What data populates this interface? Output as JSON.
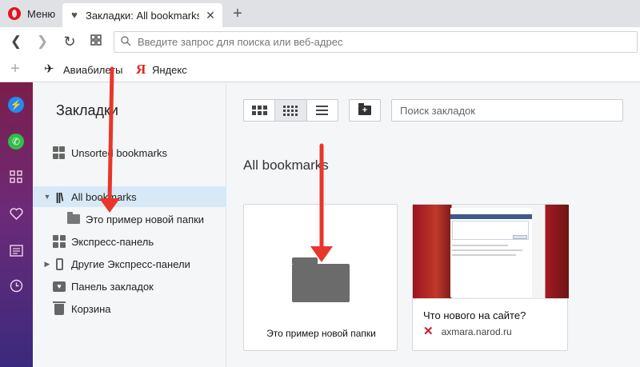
{
  "browser": {
    "menu_label": "Меню",
    "tab_title": "Закладки: All bookmarks",
    "tab_close": "✕",
    "new_tab": "+",
    "address_placeholder": "Введите запрос для поиска или веб-адрес"
  },
  "bookmarks_bar": {
    "add": "+",
    "items": [
      {
        "label": "Авиабилеты",
        "icon": "plane-icon"
      },
      {
        "label": "Яндекс",
        "icon": "yandex-icon"
      }
    ],
    "yandex_glyph": "Я"
  },
  "sidebar": {
    "icons": [
      "messenger-icon",
      "whatsapp-icon",
      "speed-dial-icon",
      "heart-icon",
      "news-icon",
      "history-icon"
    ]
  },
  "tree": {
    "title": "Закладки",
    "items": [
      {
        "label": "Unsorted bookmarks"
      },
      {
        "label": "All bookmarks"
      },
      {
        "label": "Это пример новой папки"
      },
      {
        "label": "Экспресс-панель"
      },
      {
        "label": "Другие Экспресс-панели"
      },
      {
        "label": "Панель закладок"
      },
      {
        "label": "Корзина"
      }
    ]
  },
  "main": {
    "search_placeholder": "Поиск закладок",
    "section_title": "All bookmarks",
    "folder_card_label": "Это пример новой папки",
    "site_card": {
      "title": "Что нового на сайте?",
      "url": "axmara.narod.ru"
    }
  },
  "colors": {
    "annotation_arrow": "#e8362a",
    "selected_row": "#d7e9f7",
    "opera_red": "#e3131b"
  }
}
